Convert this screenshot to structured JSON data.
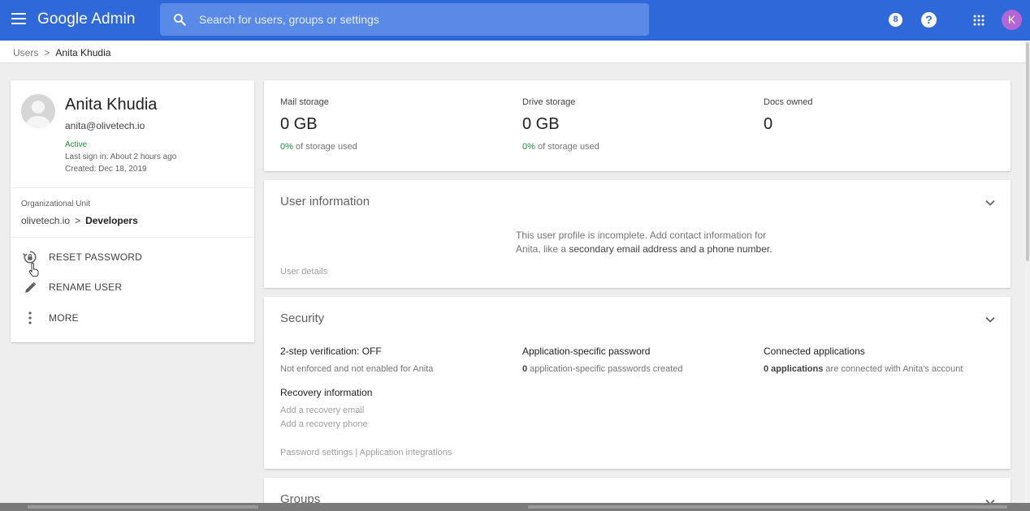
{
  "topbar": {
    "brand": "Google Admin",
    "search_placeholder": "Search for users, groups or settings",
    "badge_count": "8",
    "help_label": "?",
    "avatar_initial": "K",
    "brand_color": "#2f68d8"
  },
  "breadcrumb": {
    "parent": "Users",
    "current": "Anita Khudia"
  },
  "profile": {
    "name": "Anita Khudia",
    "email": "anita@olivetech.io",
    "status": "Active",
    "last_sign_in": "Last sign in: About 2 hours ago",
    "created": "Created: Dec 18, 2019",
    "ou_label": "Organizational Unit",
    "ou_root": "olivetech.io",
    "ou_separator": ">",
    "ou_unit": "Developers",
    "actions": [
      {
        "label": "RESET PASSWORD",
        "icon": "reset-password-icon"
      },
      {
        "label": "RENAME USER",
        "icon": "pencil-icon"
      },
      {
        "label": "MORE",
        "icon": "more-vertical-icon"
      }
    ]
  },
  "storage": {
    "mail_label": "Mail storage",
    "mail_value": "0 GB",
    "mail_pct": "0%",
    "drive_label": "Drive storage",
    "drive_value": "0 GB",
    "drive_pct": "0%",
    "used_suffix": " of storage used",
    "docs_label": "Docs owned",
    "docs_value": "0"
  },
  "user_info": {
    "title": "User information",
    "message_part1": "This user profile is incomplete. Add contact information for Anita, like a ",
    "message_highlight": "secondary email address and a phone number.",
    "details_link": "User details"
  },
  "security": {
    "title": "Security",
    "two_step_head": "2-step verification: OFF",
    "two_step_sub": "Not enforced and not enabled for Anita",
    "app_pw_head": "Application-specific password",
    "app_pw_count": "0",
    "app_pw_sub": " application-specific passwords created",
    "connected_head": "Connected applications",
    "connected_count": "0 applications",
    "connected_sub": " are connected with Anita's account",
    "recovery_head": "Recovery information",
    "recovery_email": "Add a recovery email",
    "recovery_phone": "Add a recovery phone",
    "footer_link1": "Password settings",
    "footer_sep": "|",
    "footer_link2": "Application integrations"
  },
  "groups": {
    "title": "Groups"
  }
}
